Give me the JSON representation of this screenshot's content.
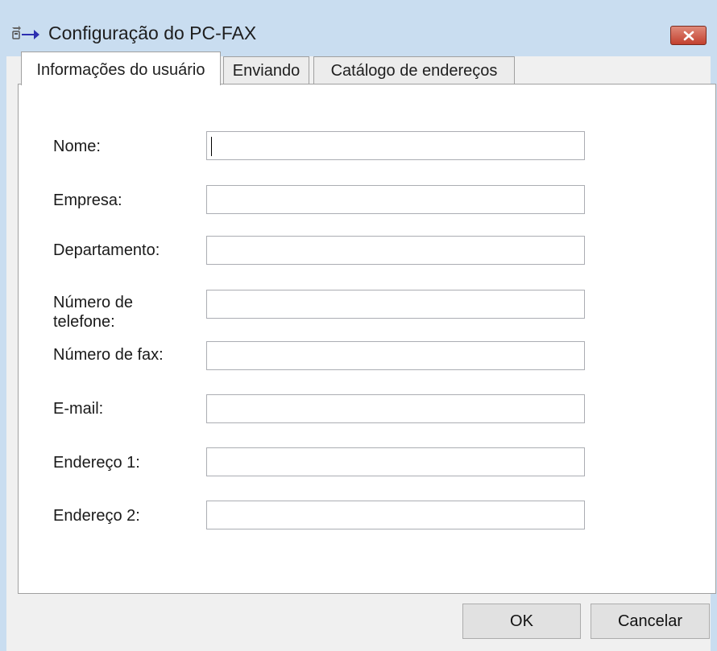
{
  "window": {
    "title": "Configuração do PC-FAX",
    "icon": "pc-fax-arrow-icon",
    "close_icon": "close-icon"
  },
  "tabs": [
    {
      "label": "Informações do usuário",
      "selected": true
    },
    {
      "label": "Enviando",
      "selected": false
    },
    {
      "label": "Catálogo de endereços",
      "selected": false
    }
  ],
  "form": {
    "fields": [
      {
        "label": "Nome:",
        "value": ""
      },
      {
        "label": "Empresa:",
        "value": ""
      },
      {
        "label": "Departamento:",
        "value": ""
      },
      {
        "label": "Número de\ntelefone:",
        "value": ""
      },
      {
        "label": "Número de fax:",
        "value": ""
      },
      {
        "label": "E-mail:",
        "value": ""
      },
      {
        "label": "Endereço 1:",
        "value": ""
      },
      {
        "label": "Endereço 2:",
        "value": ""
      }
    ]
  },
  "buttons": {
    "ok": "OK",
    "cancel": "Cancelar"
  },
  "colors": {
    "title_bar": "#c9ddf0",
    "close_button": "#c2402e",
    "panel": "#ffffff",
    "dialog": "#f0f0f0"
  }
}
